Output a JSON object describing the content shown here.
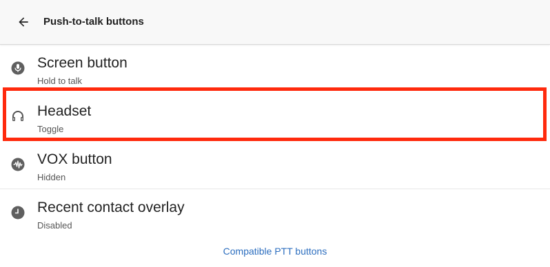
{
  "header": {
    "title": "Push-to-talk buttons",
    "back_icon": "arrow-left-icon"
  },
  "items": [
    {
      "label": "Screen button",
      "sublabel": "Hold to talk",
      "icon": "microphone-circle-icon"
    },
    {
      "label": "Headset",
      "sublabel": "Toggle",
      "icon": "headset-icon"
    },
    {
      "label": "VOX button",
      "sublabel": "Hidden",
      "icon": "waveform-circle-icon"
    },
    {
      "label": "Recent contact overlay",
      "sublabel": "Disabled",
      "icon": "clock-circle-icon"
    }
  ],
  "footer": {
    "link_label": "Compatible PTT buttons"
  },
  "colors": {
    "highlight": "#ff2a0d",
    "link": "#2c6ebf",
    "icon": "#555555"
  }
}
